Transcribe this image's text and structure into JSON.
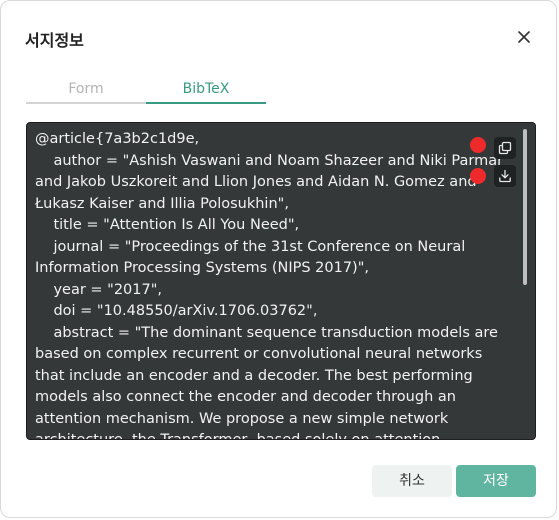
{
  "dialog": {
    "title": "서지정보",
    "close_icon": "close-icon"
  },
  "tabs": [
    {
      "label": "Form",
      "active": false
    },
    {
      "label": "BibTeX",
      "active": true
    }
  ],
  "bibtex": {
    "text": "@article{7a3b2c1d9e,\n    author = \"Ashish Vaswani and Noam Shazeer and Niki Parmar and Jakob Uszkoreit and Llion Jones and Aidan N. Gomez and Łukasz Kaiser and Illia Polosukhin\",\n    title = \"Attention Is All You Need\",\n    journal = \"Proceedings of the 31st Conference on Neural Information Processing Systems (NIPS 2017)\",\n    year = \"2017\",\n    doi = \"10.48550/arXiv.1706.03762\",\n    abstract = \"The dominant sequence transduction models are based on complex recurrent or convolutional neural networks that include an encoder and a decoder. The best performing models also connect the encoder and decoder through an attention mechanism. We propose a new simple network architecture, the Transformer, based solely on attention mechanisms, dispensing with recurrence and convolutions entirely.",
    "copy_icon": "copy-icon",
    "download_icon": "download-icon"
  },
  "footer": {
    "cancel_label": "취소",
    "save_label": "저장"
  },
  "colors": {
    "accent": "#3a9a83",
    "save_button": "#5fb59f",
    "code_background": "#343838",
    "marker": "#ee2a2a"
  }
}
